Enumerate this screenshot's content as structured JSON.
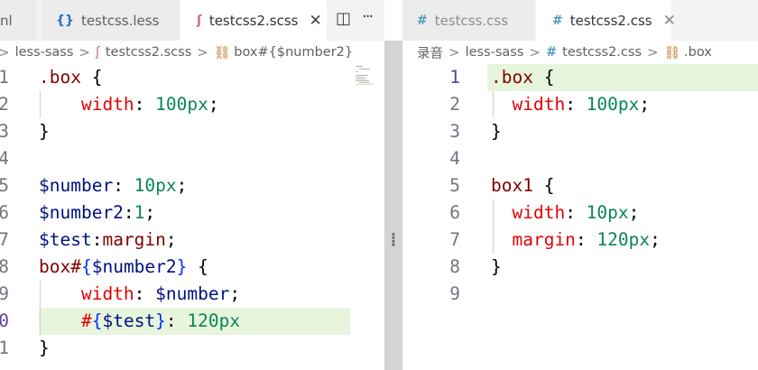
{
  "left": {
    "tabs": [
      {
        "icon": "",
        "label": "nl",
        "active": false
      },
      {
        "icon": "{}",
        "label": "testcss.less",
        "active": false
      },
      {
        "icon": "ʃ",
        "label": "testcss2.scss",
        "active": true,
        "close": "✕"
      }
    ],
    "actions": {
      "split_glyph": "◫",
      "more_glyph": "···"
    },
    "breadcrumb": [
      "less-sass",
      "testcss2.scss",
      "box#{$number2}"
    ],
    "breadcrumb_icons": [
      "ʃ",
      "⛓"
    ],
    "line_numbers": [
      "1",
      "2",
      "3",
      "4",
      "5",
      "6",
      "7",
      "8",
      "9",
      "0",
      "1"
    ],
    "lines": [
      [
        [
          ".box",
          "sel"
        ],
        [
          " ",
          "punc"
        ],
        [
          "{",
          "punc"
        ]
      ],
      [
        [
          "    ",
          "punc"
        ],
        [
          "width",
          "prop"
        ],
        [
          ": ",
          "punc"
        ],
        [
          "100",
          "num"
        ],
        [
          "px",
          "unit"
        ],
        [
          ";",
          "punc"
        ]
      ],
      [
        [
          "}",
          "punc"
        ]
      ],
      [],
      [
        [
          "$number",
          "var"
        ],
        [
          ": ",
          "punc"
        ],
        [
          "10",
          "num"
        ],
        [
          "px",
          "unit"
        ],
        [
          ";",
          "punc"
        ]
      ],
      [
        [
          "$number2",
          "var"
        ],
        [
          ":",
          "punc"
        ],
        [
          "1",
          "num"
        ],
        [
          ";",
          "punc"
        ]
      ],
      [
        [
          "$test",
          "var"
        ],
        [
          ":",
          "punc"
        ],
        [
          "margin",
          "sel"
        ],
        [
          ";",
          "punc"
        ]
      ],
      [
        [
          "box#",
          "sel"
        ],
        [
          "{",
          "brace"
        ],
        [
          "$number2",
          "var"
        ],
        [
          "}",
          "brace"
        ],
        [
          " ",
          "punc"
        ],
        [
          "{",
          "punc"
        ]
      ],
      [
        [
          "    ",
          "punc"
        ],
        [
          "width",
          "prop"
        ],
        [
          ": ",
          "punc"
        ],
        [
          "$number",
          "var"
        ],
        [
          ";",
          "punc"
        ]
      ],
      [
        [
          "    ",
          "punc"
        ],
        [
          "#",
          "prop"
        ],
        [
          "{",
          "brace"
        ],
        [
          "$test",
          "var"
        ],
        [
          "}",
          "brace"
        ],
        [
          ": ",
          "punc"
        ],
        [
          "120",
          "num"
        ],
        [
          "px",
          "unit"
        ]
      ],
      [
        [
          "}",
          "punc"
        ]
      ]
    ]
  },
  "right": {
    "tabs": [
      {
        "icon": "#",
        "label": "testcss.css",
        "active": false
      },
      {
        "icon": "#",
        "label": "testcss2.css",
        "active": true,
        "close": "✕"
      }
    ],
    "breadcrumb": [
      "录音",
      "less-sass",
      "testcss2.css",
      ".box"
    ],
    "breadcrumb_icons": [
      "#",
      "⛓"
    ],
    "line_numbers": [
      "1",
      "2",
      "3",
      "4",
      "5",
      "6",
      "7",
      "8",
      "9"
    ],
    "lines": [
      [
        [
          ".box",
          "sel"
        ],
        [
          " ",
          "punc"
        ],
        [
          "{",
          "punc"
        ]
      ],
      [
        [
          "  ",
          "punc"
        ],
        [
          "width",
          "prop"
        ],
        [
          ": ",
          "punc"
        ],
        [
          "100",
          "num"
        ],
        [
          "px",
          "unit"
        ],
        [
          ";",
          "punc"
        ]
      ],
      [
        [
          "}",
          "punc"
        ]
      ],
      [],
      [
        [
          "box1",
          "sel"
        ],
        [
          " ",
          "punc"
        ],
        [
          "{",
          "punc"
        ]
      ],
      [
        [
          "  ",
          "punc"
        ],
        [
          "width",
          "prop"
        ],
        [
          ": ",
          "punc"
        ],
        [
          "10",
          "num"
        ],
        [
          "px",
          "unit"
        ],
        [
          ";",
          "punc"
        ]
      ],
      [
        [
          "  ",
          "punc"
        ],
        [
          "margin",
          "prop"
        ],
        [
          ": ",
          "punc"
        ],
        [
          "120",
          "num"
        ],
        [
          "px",
          "unit"
        ],
        [
          ";",
          "punc"
        ]
      ],
      [
        [
          "}",
          "punc"
        ]
      ],
      []
    ]
  },
  "splitter_glyph": "⁞",
  "colors": {
    "selector": "#800000",
    "property": "#e50000",
    "number": "#098658",
    "variable": "#001080",
    "line_highlight": "#e7f5dc",
    "current_line_number": "#5b3fa0"
  }
}
